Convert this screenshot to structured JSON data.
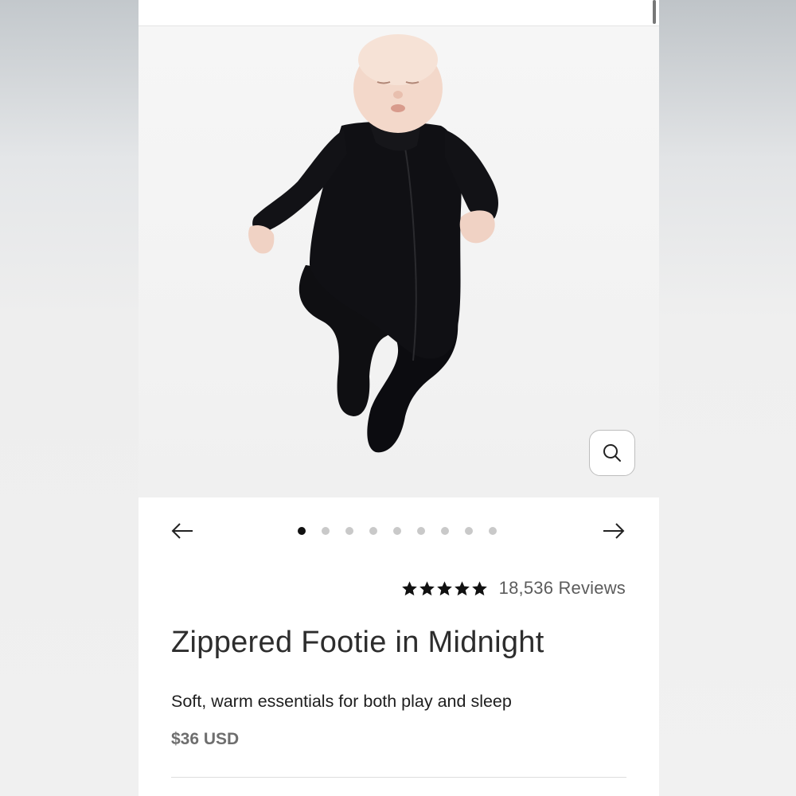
{
  "product": {
    "reviews_text": "18,536 Reviews",
    "rating": 5,
    "title": "Zippered Footie in Midnight",
    "subtitle": "Soft, warm essentials for both play and sleep",
    "price": "$36 USD"
  },
  "carousel": {
    "image_count": 9,
    "active_index": 0,
    "prev_icon": "arrow-left-icon",
    "next_icon": "arrow-right-icon",
    "zoom_icon": "search-icon"
  },
  "colors": {
    "background": "#ffffff",
    "text": "#2d2d2d",
    "muted": "#6e6e6e",
    "dot_active": "#111111",
    "dot_inactive": "#c9c9c9"
  }
}
